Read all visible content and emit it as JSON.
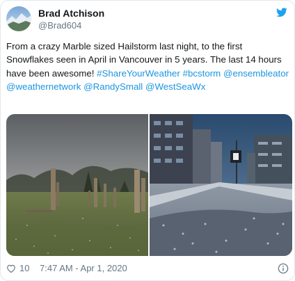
{
  "author": {
    "display_name": "Brad Atchison",
    "handle": "@Brad604"
  },
  "tweet": {
    "segments": [
      {
        "type": "text",
        "value": "From a crazy Marble sized Hailstorm last night, to the first Snowflakes seen in April in Vancouver in 5 years. The last 14 hours have been awesome! "
      },
      {
        "type": "hashtag",
        "value": "#ShareYourWeather"
      },
      {
        "type": "text",
        "value": " "
      },
      {
        "type": "hashtag",
        "value": "#bcstorm"
      },
      {
        "type": "text",
        "value": " "
      },
      {
        "type": "mention",
        "value": "@ensembleator"
      },
      {
        "type": "text",
        "value": " "
      },
      {
        "type": "mention",
        "value": "@weathernetwork"
      },
      {
        "type": "text",
        "value": " "
      },
      {
        "type": "mention",
        "value": "@RandySmall"
      },
      {
        "type": "text",
        "value": " "
      },
      {
        "type": "mention",
        "value": "@WestSeaWx"
      }
    ]
  },
  "media": {
    "photo_1": "field-with-wooden-totem-posts-photo",
    "photo_2": "snowy-city-sidewalk-photo"
  },
  "footer": {
    "like_count": "10",
    "timestamp": "7:47 AM - Apr 1, 2020"
  },
  "colors": {
    "link": "#1b95e0",
    "text": "#14171a",
    "muted": "#657786",
    "twitter_blue": "#1da1f2"
  },
  "icons": {
    "brand": "twitter-bird-icon",
    "like": "heart-icon",
    "info": "info-icon"
  }
}
